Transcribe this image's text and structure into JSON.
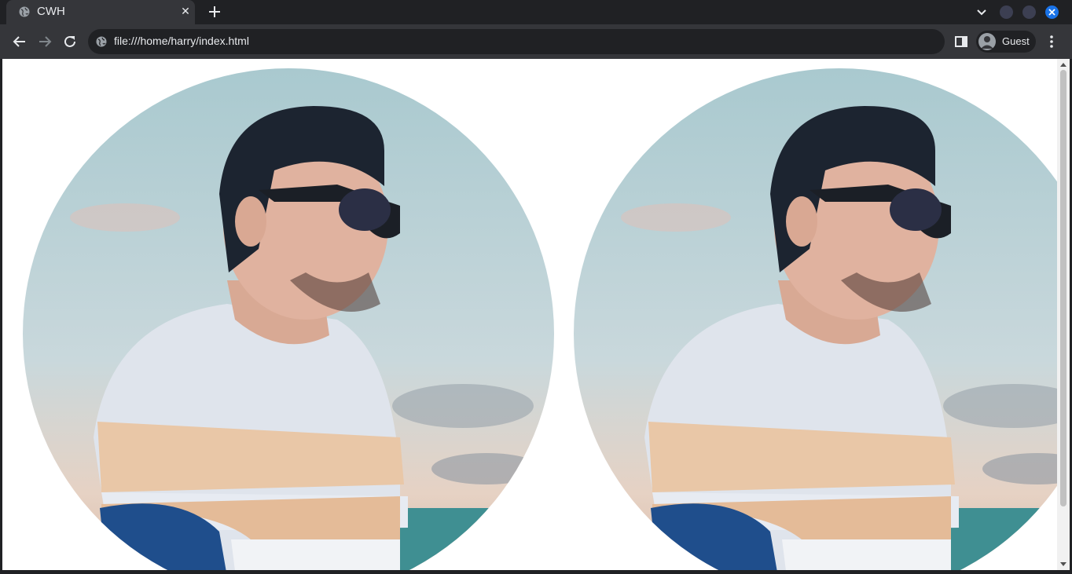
{
  "browser": {
    "tab": {
      "title": "CWH",
      "favicon": "globe-icon"
    },
    "address_bar": {
      "url": "file:///home/harry/index.html",
      "icon": "globe-icon"
    },
    "profile": {
      "label": "Guest",
      "icon": "account-circle-icon"
    },
    "accent_color": "#1a73e8"
  },
  "page": {
    "images": [
      {
        "description_icon": "portrait-photo",
        "shape": "circle"
      },
      {
        "description_icon": "portrait-photo",
        "shape": "circle"
      }
    ]
  }
}
